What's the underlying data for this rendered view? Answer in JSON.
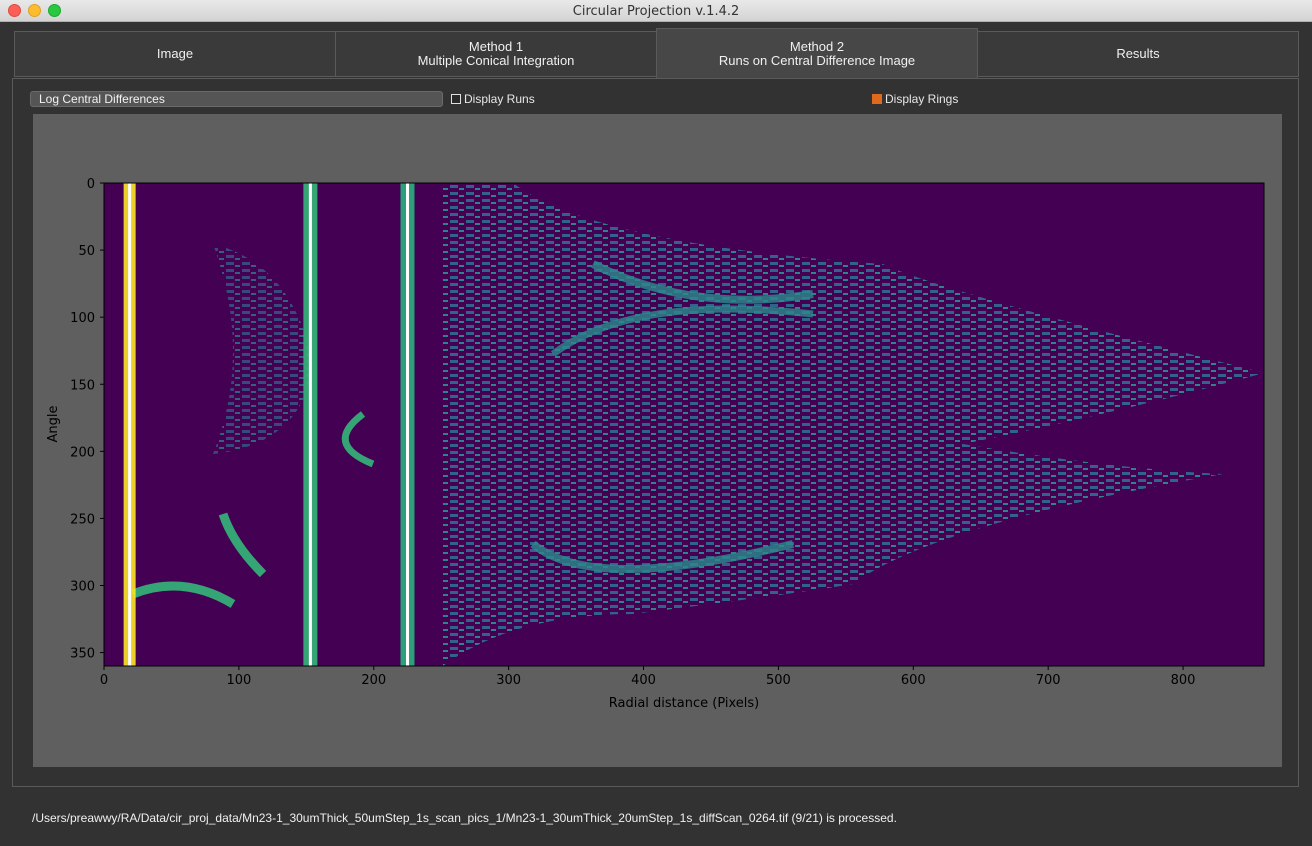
{
  "window": {
    "title": "Circular Projection v.1.4.2"
  },
  "tabs": [
    {
      "line1": "Image",
      "line2": ""
    },
    {
      "line1": "Method 1",
      "line2": "Multiple Conical Integration"
    },
    {
      "line1": "Method 2",
      "line2": "Runs on Central Difference Image"
    },
    {
      "line1": "Results",
      "line2": ""
    }
  ],
  "controls": {
    "mode_value": "Log Central Differences",
    "display_runs": {
      "label": "Display Runs",
      "checked": false
    },
    "display_rings": {
      "label": "Display Rings",
      "checked": true
    }
  },
  "chart_data": {
    "type": "heatmap",
    "xlabel": "Radial distance (Pixels)",
    "ylabel": "Angle",
    "xlim": [
      0,
      860
    ],
    "ylim": [
      0,
      360
    ],
    "y_inverted": true,
    "x_ticks": [
      0,
      100,
      200,
      300,
      400,
      500,
      600,
      700,
      800
    ],
    "y_ticks": [
      0,
      50,
      100,
      150,
      200,
      250,
      300,
      350
    ],
    "colormap": "viridis",
    "background_color": "#440154",
    "ring_lines_x": [
      19,
      153,
      225
    ],
    "ring_line_color": "#ffffff"
  },
  "status": {
    "text": "/Users/preawwy/RA/Data/cir_proj_data/Mn23-1_30umThick_50umStep_1s_scan_pics_1/Mn23-1_30umThick_20umStep_1s_diffScan_0264.tif (9/21) is processed."
  }
}
